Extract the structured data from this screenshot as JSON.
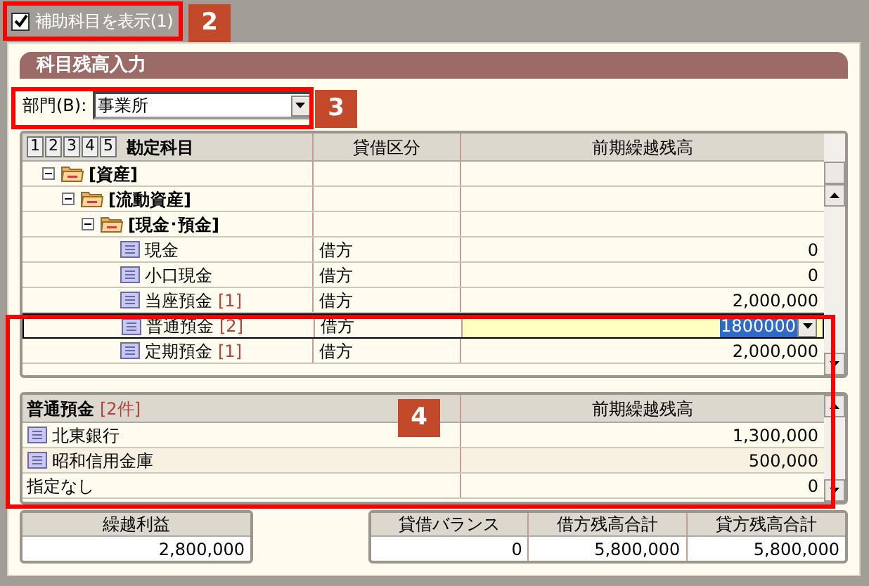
{
  "toolbar": {
    "show_sub_accounts": {
      "label": "補助科目を表示(1)",
      "checked": true
    },
    "callout": "2"
  },
  "panel": {
    "title": "科目残高入力"
  },
  "department": {
    "label": "部門(B):",
    "value": "事業所",
    "callout": "3"
  },
  "account_grid": {
    "level_buttons": [
      "1",
      "2",
      "3",
      "4",
      "5"
    ],
    "columns": [
      "勘定科目",
      "貸借区分",
      "前期繰越残高"
    ],
    "rows": [
      {
        "kind": "folder",
        "name": "[資産]",
        "expanded": true,
        "children": [
          {
            "kind": "folder",
            "name": "[流動資産]",
            "expanded": true,
            "children": [
              {
                "kind": "folder",
                "name": "[現金･預金]",
                "expanded": true,
                "children": [
                  {
                    "kind": "account",
                    "name": "現金",
                    "side": "借方",
                    "balance": "0",
                    "selected": false
                  },
                  {
                    "kind": "account",
                    "name": "小口現金",
                    "side": "借方",
                    "balance": "0",
                    "selected": false
                  },
                  {
                    "kind": "account",
                    "name": "当座預金",
                    "count": "[1]",
                    "side": "借方",
                    "balance": "2,000,000",
                    "selected": false
                  },
                  {
                    "kind": "account",
                    "name": "普通預金",
                    "count": "[2]",
                    "side": "借方",
                    "balance": "1800000",
                    "selected": true
                  },
                  {
                    "kind": "account",
                    "name": "定期預金",
                    "count": "[1]",
                    "side": "借方",
                    "balance": "2,000,000",
                    "selected": false
                  }
                ]
              }
            ]
          }
        ]
      }
    ]
  },
  "sub_account_grid": {
    "title": "普通預金",
    "count": "[2件]",
    "column": "前期繰越残高",
    "callout": "4",
    "rows": [
      {
        "kind": "account",
        "name": "北東銀行",
        "balance": "1,300,000"
      },
      {
        "kind": "account",
        "name": "昭和信用金庫",
        "balance": "500,000"
      },
      {
        "kind": "plain",
        "name": "指定なし",
        "balance": "0"
      }
    ]
  },
  "summary": {
    "carried_profit": {
      "label": "繰越利益",
      "value": "2,800,000"
    },
    "totals": [
      {
        "label": "貸借バランス",
        "value": "0"
      },
      {
        "label": "借方残高合計",
        "value": "5,800,000"
      },
      {
        "label": "貸方残高合計",
        "value": "5,800,000"
      }
    ]
  }
}
